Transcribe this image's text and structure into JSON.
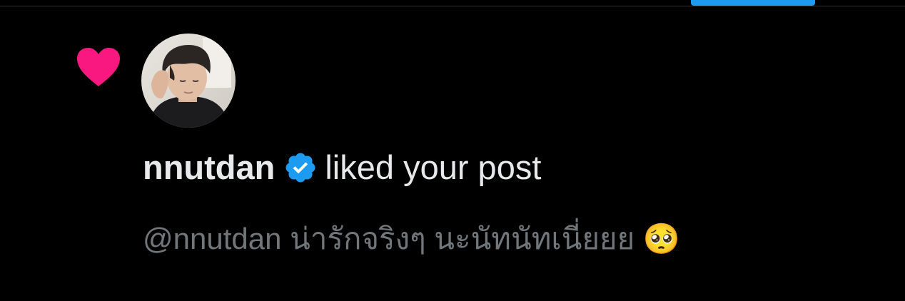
{
  "header": {
    "active_tab_color": "#1d9bf0"
  },
  "notification": {
    "type_icon": "heart-icon",
    "type_icon_color": "#f91880",
    "avatar": "profile-photo",
    "username": "nnutdan",
    "verified_icon": "verified-badge-icon",
    "verified_color": "#1d9bf0",
    "action_text": "liked your post",
    "post_text": "@nnutdan น่ารักจริงๆ นะนัทนัทเนี่ยยย 🥺"
  }
}
